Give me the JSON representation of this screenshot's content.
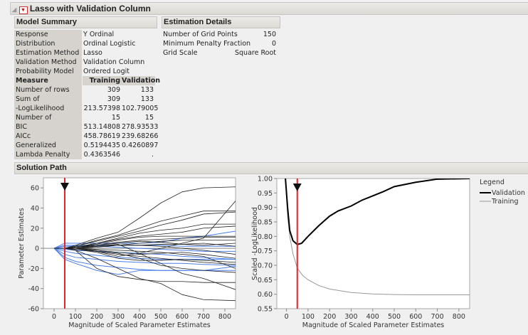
{
  "title": "Lasso with Validation Column",
  "model_summary": {
    "header": "Model Summary",
    "rows": [
      [
        "Response",
        "Y Ordinal"
      ],
      [
        "Distribution",
        "Ordinal Logistic"
      ],
      [
        "Estimation Method",
        "Lasso"
      ],
      [
        "Validation Method",
        "Validation Column"
      ],
      [
        "Probability Model Link",
        "Ordered Logit"
      ]
    ],
    "measure_headers": [
      "Measure",
      "Training",
      "Validation"
    ],
    "measures": [
      [
        "Number of rows",
        "309",
        "133"
      ],
      [
        "Sum of Frequencies",
        "309",
        "133"
      ],
      [
        "-LogLikelihood",
        "213.57398",
        "102.79005"
      ],
      [
        "Number of Parameters",
        "15",
        "15"
      ],
      [
        "BIC",
        "513.14808",
        "278.93533"
      ],
      [
        "AICc",
        "458.78619",
        "239.68266"
      ],
      [
        "Generalized RSquare",
        "0.5194435",
        "0.4260897"
      ],
      [
        "Lambda Penalty",
        "0.4363546",
        "."
      ]
    ]
  },
  "estimation_details": {
    "header": "Estimation Details",
    "rows": [
      [
        "Number of Grid Points",
        "150"
      ],
      [
        "Minimum Penalty Fraction",
        "0"
      ],
      [
        "Grid Scale",
        "Square Root"
      ]
    ]
  },
  "solution_path": {
    "header": "Solution Path"
  },
  "chart_data": [
    {
      "type": "line",
      "title": "Parameter Estimates path",
      "xlabel": "Magnitude of Scaled Parameter Estimates",
      "ylabel": "Parameter Estimates",
      "xlim": [
        -50,
        850
      ],
      "ylim": [
        -60,
        70
      ],
      "xticks": [
        "0",
        "100",
        "200",
        "300",
        "400",
        "500",
        "600",
        "700",
        "800"
      ],
      "yticks": [
        "-60",
        "-40",
        "-20",
        "0",
        "20",
        "40",
        "60"
      ],
      "selected_x": 50,
      "x": [
        0,
        50,
        100,
        200,
        300,
        400,
        500,
        600,
        700,
        850
      ],
      "series_black": [
        [
          0,
          0,
          3,
          10,
          16,
          30,
          45,
          56,
          60,
          61
        ],
        [
          0,
          0,
          2,
          8,
          13,
          20,
          27,
          32,
          37,
          37
        ],
        [
          0,
          0,
          2,
          7,
          12,
          17,
          23,
          28,
          34,
          36
        ],
        [
          0,
          0,
          1,
          5,
          10,
          15,
          18,
          20,
          24,
          24
        ],
        [
          0,
          0,
          1,
          5,
          9,
          12,
          14,
          16,
          20,
          22
        ],
        [
          0,
          0,
          1,
          4,
          8,
          11,
          12,
          12,
          12,
          12
        ],
        [
          0,
          0,
          -2,
          -20,
          -28,
          -31,
          -33,
          -33,
          -34,
          -34
        ],
        [
          0,
          0,
          -2,
          -10,
          -20,
          -30,
          -35,
          -46,
          -51,
          -52
        ],
        [
          0,
          0,
          0,
          -2,
          -5,
          -10,
          -17,
          -20,
          -22,
          -24
        ],
        [
          0,
          0,
          1,
          3,
          5,
          7,
          6,
          4,
          3,
          5
        ],
        [
          0,
          0,
          -1,
          -3,
          -6,
          -8,
          -10,
          -12,
          -14,
          -16
        ],
        [
          0,
          0,
          0,
          2,
          4,
          -5,
          -15,
          -25,
          -30,
          -41
        ],
        [
          0,
          0,
          0,
          -3,
          -8,
          -5,
          0,
          5,
          10,
          47
        ],
        [
          0,
          0,
          1,
          2,
          3,
          3,
          2,
          0,
          -2,
          -6
        ],
        [
          0,
          0,
          0,
          -2,
          -4,
          -6,
          -5,
          -4,
          -6,
          -10
        ],
        [
          0,
          0,
          0,
          1,
          3,
          5,
          7,
          8,
          8,
          8
        ],
        [
          0,
          0,
          -1,
          -4,
          -10,
          -12,
          -12,
          -11,
          -12,
          -14
        ],
        [
          0,
          0,
          1,
          3,
          6,
          8,
          9,
          10,
          11,
          11
        ],
        [
          0,
          0,
          0,
          -1,
          -2,
          -3,
          -4,
          -6,
          -8,
          -20
        ],
        [
          0,
          0,
          0,
          2,
          3,
          3,
          4,
          4,
          5,
          2
        ]
      ],
      "series_blue": [
        [
          0,
          5,
          5,
          5,
          5,
          5,
          6,
          10,
          12,
          17
        ],
        [
          0,
          3,
          3,
          3,
          3,
          3,
          3,
          2,
          2,
          2
        ],
        [
          0,
          -3,
          -5,
          -7,
          -9,
          -10,
          -11,
          -11,
          -11,
          -11
        ],
        [
          0,
          -6,
          -9,
          -11,
          -13,
          -14,
          -15,
          -15,
          -16,
          -17
        ],
        [
          0,
          -9,
          -13,
          -17,
          -19,
          -21,
          -22,
          -22,
          -22,
          -22
        ],
        [
          0,
          -11,
          -15,
          -22,
          -26,
          -22,
          -22,
          -22,
          -22,
          -18
        ],
        [
          0,
          2,
          2,
          2,
          1,
          0,
          -1,
          -2,
          -3,
          -3
        ],
        [
          0,
          -1,
          -2,
          -3,
          -4,
          -5,
          -6,
          -8,
          -9,
          -11
        ]
      ]
    },
    {
      "type": "line",
      "title": "Scaled -LogLikelihood path",
      "xlabel": "Magnitude of Scaled Parameter Estimates",
      "ylabel": "Scaled -LogLikelihood",
      "xlim": [
        -45,
        850
      ],
      "ylim": [
        0.55,
        1.0
      ],
      "xticks": [
        "0",
        "100",
        "200",
        "300",
        "400",
        "500",
        "600",
        "700",
        "800"
      ],
      "yticks": [
        "0.55",
        "0.60",
        "0.65",
        "0.70",
        "0.75",
        "0.80",
        "0.85",
        "0.90",
        "0.95",
        "1.00"
      ],
      "selected_x": 50,
      "legend": {
        "title": "Legend",
        "position": "right",
        "entries": [
          "Validation",
          "Training"
        ]
      },
      "series": [
        {
          "name": "Validation",
          "x": [
            -5,
            5,
            15,
            30,
            50,
            70,
            100,
            150,
            200,
            240,
            300,
            350,
            400,
            450,
            500,
            600,
            700,
            850
          ],
          "y": [
            1.0,
            0.9,
            0.82,
            0.785,
            0.772,
            0.776,
            0.8,
            0.837,
            0.87,
            0.888,
            0.905,
            0.925,
            0.94,
            0.955,
            0.972,
            0.987,
            0.998,
            1.0
          ]
        },
        {
          "name": "Training",
          "x": [
            -5,
            5,
            15,
            30,
            50,
            75,
            100,
            150,
            200,
            300,
            400,
            500,
            600,
            700,
            850
          ],
          "y": [
            1.0,
            0.87,
            0.8,
            0.74,
            0.69,
            0.665,
            0.65,
            0.63,
            0.618,
            0.606,
            0.601,
            0.599,
            0.598,
            0.598,
            0.598
          ]
        }
      ]
    }
  ],
  "colors": {
    "selected_line": "#e8222a",
    "blue_path": "#4a7fe8",
    "black_path": "#222222"
  }
}
